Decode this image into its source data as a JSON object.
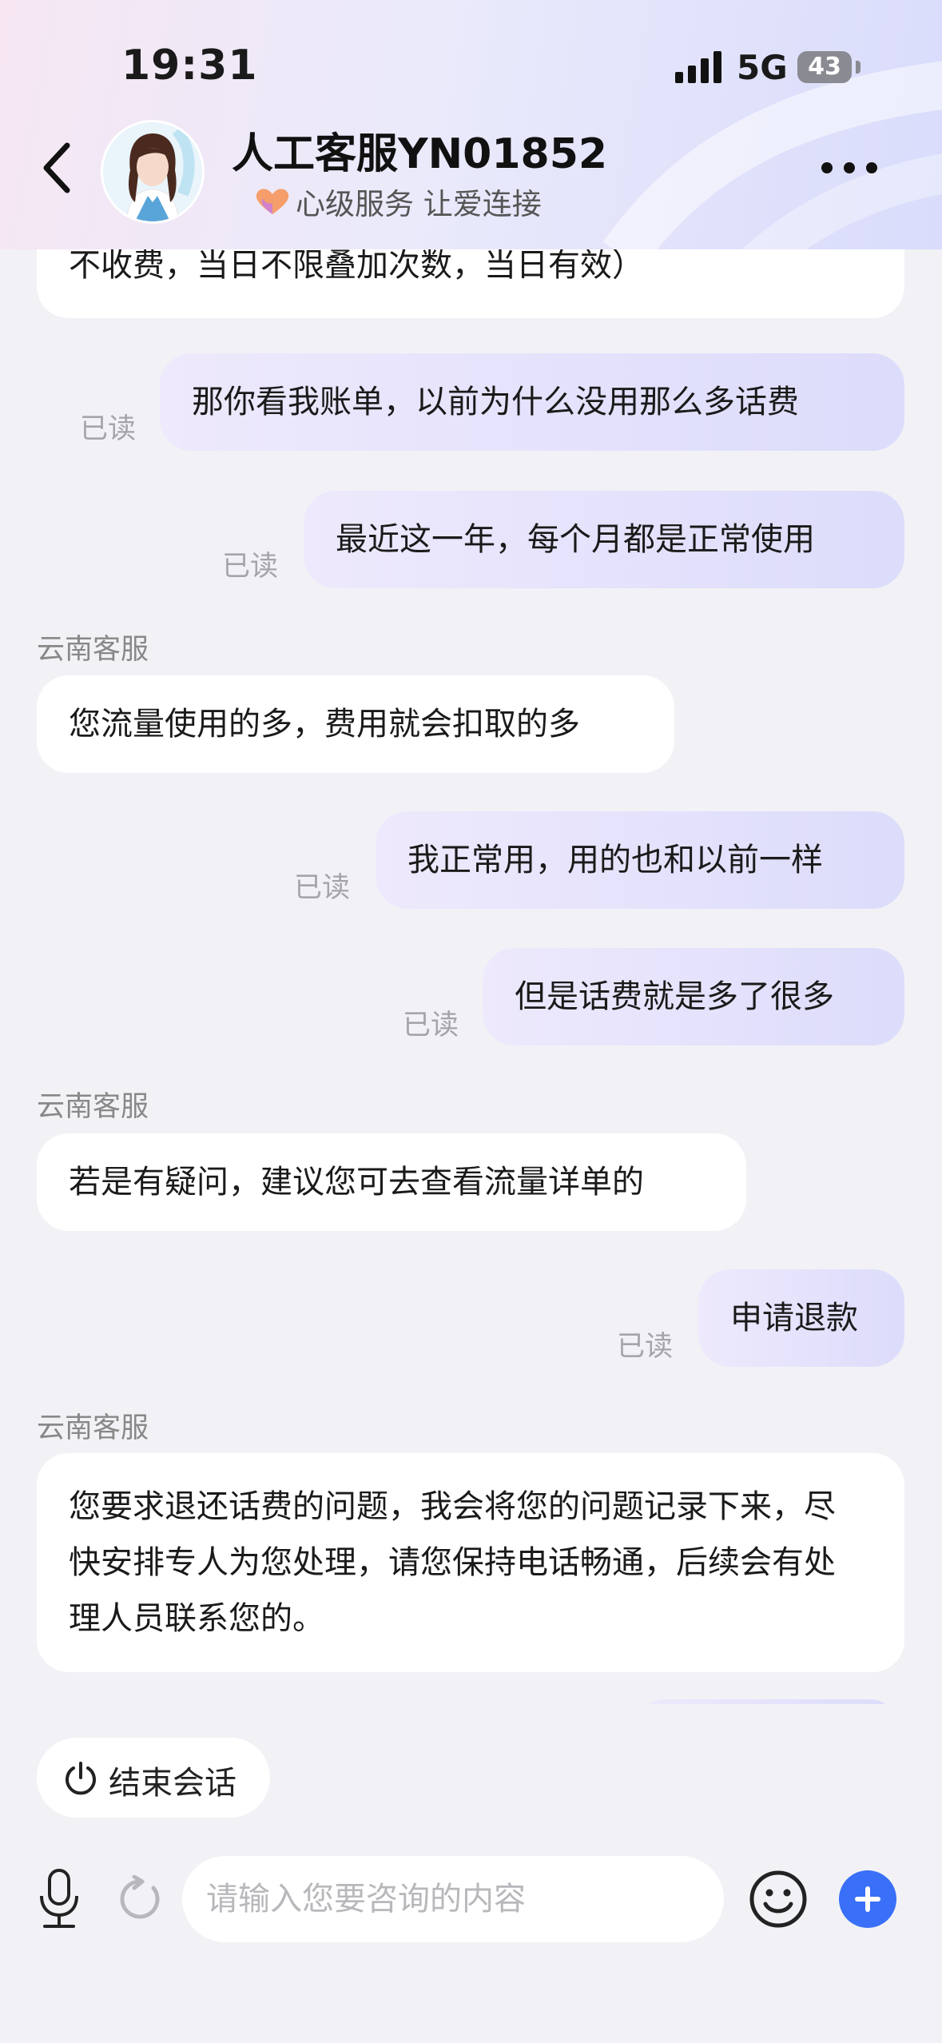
{
  "status_bar": {
    "time": "19:31",
    "network": "5G",
    "battery": "43"
  },
  "header": {
    "agent_name": "人工客服YN01852",
    "tagline": "心级服务 让爱连接"
  },
  "messages": [
    {
      "side": "left",
      "text": "不收费，当日不限叠加次数，当日有效）"
    },
    {
      "side": "right",
      "text": "那你看我账单，以前为什么没用那么多话费",
      "status": "已读"
    },
    {
      "side": "right",
      "text": "最近这一年，每个月都是正常使用",
      "status": "已读"
    },
    {
      "side": "left",
      "sender": "云南客服",
      "text": "您流量使用的多，费用就会扣取的多"
    },
    {
      "side": "right",
      "text": "我正常用，用的也和以前一样",
      "status": "已读"
    },
    {
      "side": "right",
      "text": "但是话费就是多了很多",
      "status": "已读"
    },
    {
      "side": "left",
      "sender": "云南客服",
      "text": "若是有疑问，建议您可去查看流量详单的"
    },
    {
      "side": "right",
      "text": "申请退款",
      "status": "已读"
    },
    {
      "side": "left",
      "sender": "云南客服",
      "text": "您要求退还话费的问题，我会将您的问题记录下来，尽快安排专人为您处理，请您保持电话畅通，后续会有处理人员联系您的。"
    }
  ],
  "end_session_label": "结束会话",
  "input": {
    "placeholder": "请输入您要咨询的内容"
  },
  "colors": {
    "accent": "#3a6ff7",
    "right_bubble": "#dcdcfb",
    "left_bubble": "#ffffff"
  },
  "icons": [
    "back-icon",
    "more-icon",
    "power-icon",
    "microphone-icon",
    "refresh-icon",
    "emoji-icon",
    "plus-icon"
  ]
}
